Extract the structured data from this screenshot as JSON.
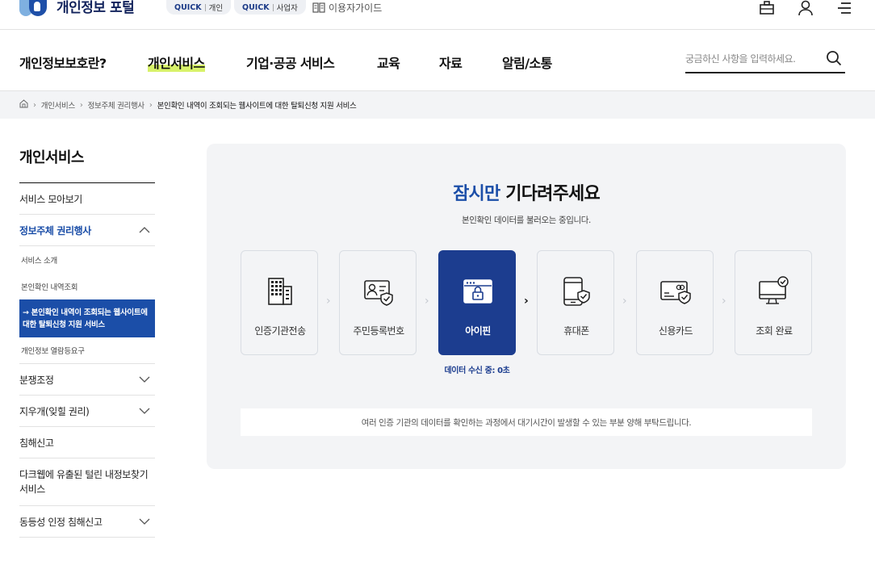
{
  "header": {
    "logo_text": "개인정보 포털",
    "quick_personal": {
      "tag": "QUICK",
      "label": "개인"
    },
    "quick_business": {
      "tag": "QUICK",
      "label": "사업자"
    },
    "guide_label": "이용자가이드",
    "icons": [
      "briefcase-icon",
      "user-icon",
      "menu-icon"
    ]
  },
  "gnb": {
    "items": [
      "개인정보보호란?",
      "개인서비스",
      "기업·공공 서비스",
      "교육",
      "자료",
      "알림/소통"
    ],
    "active_index": 1,
    "search_placeholder": "궁금하신 사항을 입력하세요."
  },
  "breadcrumb": {
    "items": [
      "개인서비스",
      "정보주체 권리행사",
      "본인확인 내역이 조회되는 웹사이트에 대한 탈퇴신청 지원 서비스"
    ]
  },
  "sidebar": {
    "title": "개인서비스",
    "items": [
      {
        "label": "서비스 모아보기"
      },
      {
        "label": "정보주체 권리행사"
      },
      {
        "label": "분쟁조정"
      },
      {
        "label": "지우개(잊힐 권리)"
      },
      {
        "label": "침해신고"
      },
      {
        "label": "다크웹에 유출된 털린 내정보찾기 서비스"
      },
      {
        "label": "동등성 인정 침해신고"
      }
    ],
    "sub_items": [
      {
        "label": "서비스 소개"
      },
      {
        "label": "본인확인 내역조회"
      },
      {
        "label": "→ 본인확인 내역이 조회되는 웹사이트에 대한 탈퇴신청 지원 서비스"
      },
      {
        "label": "개인정보 열람등요구"
      }
    ]
  },
  "main": {
    "title_highlight": "잠시만",
    "title_rest": " 기다려주세요",
    "subtitle": "본인확인 데이터를 불러오는 중입니다.",
    "steps": [
      {
        "label": "인증기관전송",
        "icon": "building-icon"
      },
      {
        "label": "주민등록번호",
        "icon": "id-card-icon"
      },
      {
        "label": "아이핀",
        "icon": "ipin-lock-icon"
      },
      {
        "label": "휴대폰",
        "icon": "phone-shield-icon"
      },
      {
        "label": "신용카드",
        "icon": "credit-card-icon"
      },
      {
        "label": "조회 완료",
        "icon": "monitor-check-icon"
      }
    ],
    "active_step": 2,
    "progress_text": "데이터 수신 중: 0초",
    "notice": "여러 인증 기관의 데이터를 확인하는 과정에서 대기시간이 발생할 수 있는 부분 양해 부탁드립니다."
  },
  "colors": {
    "brand": "#1b4ea8",
    "active_step": "#1c3d8f",
    "nav_highlight": "#d8f26a"
  }
}
